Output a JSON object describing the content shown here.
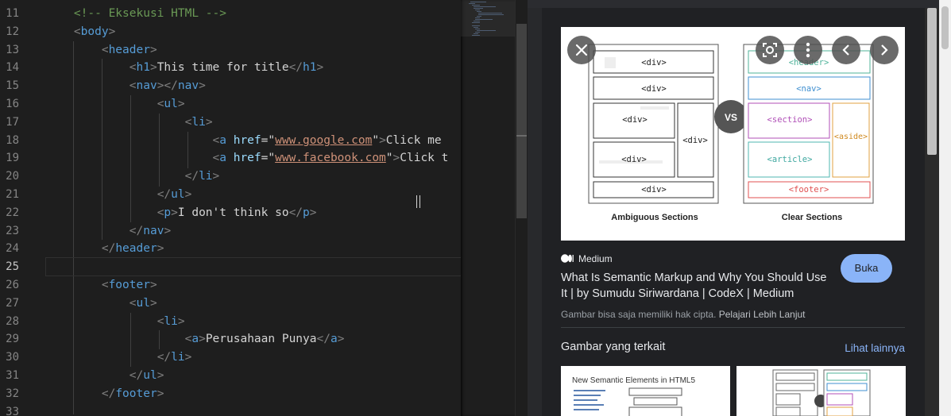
{
  "editor": {
    "line_numbers": [
      "11",
      "12",
      "13",
      "14",
      "15",
      "16",
      "17",
      "18",
      "19",
      "20",
      "21",
      "22",
      "23",
      "24",
      "25",
      "26",
      "27",
      "28",
      "29",
      "30",
      "31",
      "32",
      "33"
    ],
    "active_line": "25",
    "code": {
      "l11_comment": "<!-- Eksekusi HTML -->",
      "tag_body": "body",
      "tag_header": "header",
      "tag_h1": "h1",
      "h1_text": "This time for title",
      "tag_nav": "nav",
      "tag_ul": "ul",
      "tag_li": "li",
      "tag_a": "a",
      "attr_href": "href",
      "href_google": "www.google.com",
      "href_facebook": "www.facebook.com",
      "link1_text": "Click me",
      "link2_text": "Click t",
      "tag_p": "p",
      "p_text": "I don't think so",
      "tag_footer": "footer",
      "footer_a_text": "Perusahaan Punya"
    }
  },
  "image_panel": {
    "preview_image": {
      "left_heading": "Ambiguous Sections",
      "right_heading": "Clear Sections",
      "vs_label": "VS",
      "div_tag": "<div>",
      "header_tag": "<header>",
      "nav_tag": "<nav>",
      "section_tag": "<section>",
      "aside_tag": "<aside>",
      "article_tag": "<article>",
      "footer_tag": "<footer>"
    },
    "overlay_icons": [
      "close-icon",
      "lens-icon",
      "more-vert-icon",
      "chevron-left-icon",
      "chevron-right-icon"
    ],
    "source_name": "Medium",
    "title": "What Is Semantic Markup and Why You Should Use It | by Sumudu Siriwardana | CodeX | Medium",
    "open_button": "Buka",
    "copyright_text": "Gambar bisa saja memiliki hak cipta.",
    "learn_more": "Pelajari Lebih Lanjut",
    "related_title": "Gambar yang terkait",
    "see_more": "Lihat lainnya",
    "thumb1_title": "New Semantic Elements in HTML5",
    "accent_color": "#8ab4f8"
  }
}
